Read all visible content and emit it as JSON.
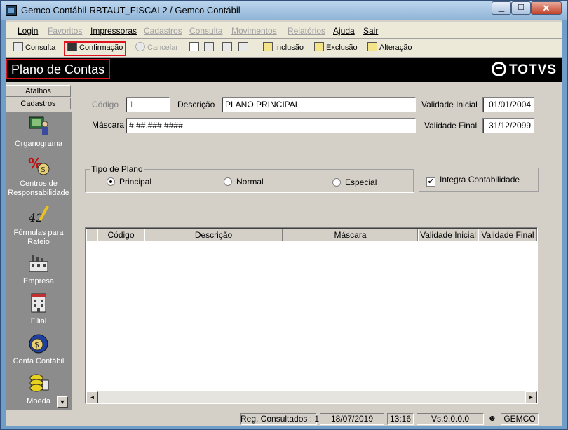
{
  "window": {
    "title": "Gemco Contábil-RBTAUT_FISCAL2 / Gemco Contábil",
    "min_label": "▁",
    "max_label": "☐",
    "close_label": "✕"
  },
  "menu": [
    {
      "label": "Login",
      "enabled": true
    },
    {
      "label": "Favoritos",
      "enabled": false
    },
    {
      "label": "Impressoras",
      "enabled": true
    },
    {
      "label": "Cadastros",
      "enabled": false
    },
    {
      "label": "Consulta",
      "enabled": false
    },
    {
      "label": "Movimentos",
      "enabled": false
    },
    {
      "label": "Relatórios",
      "enabled": false
    },
    {
      "label": "Ajuda",
      "enabled": true
    },
    {
      "label": "Sair",
      "enabled": true
    }
  ],
  "toolbar": {
    "consulta": "Consulta",
    "confirmacao": "Confirmação",
    "cancelar": "Cancelar",
    "inclusao": "Inclusão",
    "exclusao": "Exclusão",
    "alteracao": "Alteração"
  },
  "header": {
    "title": "Plano de Contas",
    "logo": "TOTVS"
  },
  "sidebar": {
    "tabs": [
      "Atalhos",
      "Cadastros"
    ],
    "items": [
      {
        "label": "Organograma",
        "icon": "organogram-icon"
      },
      {
        "label": "Centros de Responsabilidade",
        "icon": "percent-money-icon"
      },
      {
        "label": "Fórmulas para Rateio",
        "icon": "formula-pen-icon"
      },
      {
        "label": "Empresa",
        "icon": "factory-icon"
      },
      {
        "label": "Filial",
        "icon": "building-icon"
      },
      {
        "label": "Conta Contábil",
        "icon": "money-bag-icon"
      },
      {
        "label": "Moeda",
        "icon": "coins-icon"
      }
    ],
    "scroll_glyph": "▼"
  },
  "form": {
    "codigo_label": "Código",
    "codigo_value": "1",
    "descricao_label": "Descrição",
    "descricao_value": "PLANO PRINCIPAL",
    "validade_inicial_label": "Validade Inicial",
    "validade_inicial_value": "01/01/2004",
    "mascara_label": "Máscara",
    "mascara_value": "#.##.###.####",
    "validade_final_label": "Validade Final",
    "validade_final_value": "31/12/2099",
    "tipo_plano_label": "Tipo de Plano",
    "tipo_plano_options": [
      "Principal",
      "Normal",
      "Especial"
    ],
    "tipo_plano_selected": "Principal",
    "integra_label": "Integra Contabilidade",
    "integra_checked": true
  },
  "grid": {
    "columns": [
      "",
      "Código",
      "Descrição",
      "Máscara",
      "Validade Inicial",
      "Validade Final"
    ],
    "rows": [],
    "scroll_left": "◄",
    "scroll_right": "►"
  },
  "status": {
    "reg_consultados": "Reg. Consultados : 1",
    "date": "18/07/2019",
    "time": "13:16",
    "version": "Vs.9.0.0.0",
    "user": "GEMCO"
  }
}
